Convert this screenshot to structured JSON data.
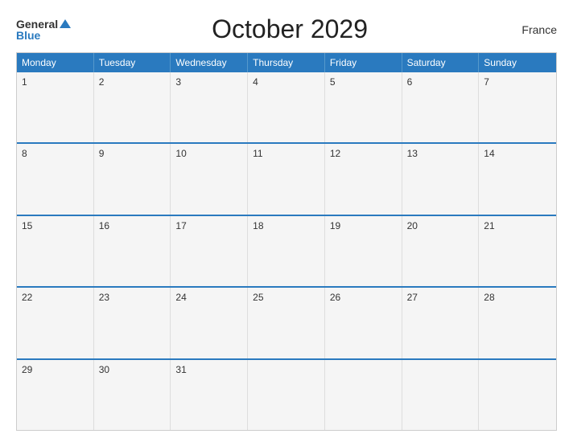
{
  "header": {
    "logo_general": "General",
    "logo_blue": "Blue",
    "title": "October 2029",
    "country": "France"
  },
  "calendar": {
    "days_of_week": [
      "Monday",
      "Tuesday",
      "Wednesday",
      "Thursday",
      "Friday",
      "Saturday",
      "Sunday"
    ],
    "weeks": [
      [
        {
          "num": "1"
        },
        {
          "num": "2"
        },
        {
          "num": "3"
        },
        {
          "num": "4"
        },
        {
          "num": "5"
        },
        {
          "num": "6"
        },
        {
          "num": "7"
        }
      ],
      [
        {
          "num": "8"
        },
        {
          "num": "9"
        },
        {
          "num": "10"
        },
        {
          "num": "11"
        },
        {
          "num": "12"
        },
        {
          "num": "13"
        },
        {
          "num": "14"
        }
      ],
      [
        {
          "num": "15"
        },
        {
          "num": "16"
        },
        {
          "num": "17"
        },
        {
          "num": "18"
        },
        {
          "num": "19"
        },
        {
          "num": "20"
        },
        {
          "num": "21"
        }
      ],
      [
        {
          "num": "22"
        },
        {
          "num": "23"
        },
        {
          "num": "24"
        },
        {
          "num": "25"
        },
        {
          "num": "26"
        },
        {
          "num": "27"
        },
        {
          "num": "28"
        }
      ],
      [
        {
          "num": "29"
        },
        {
          "num": "30"
        },
        {
          "num": "31"
        },
        {
          "num": ""
        },
        {
          "num": ""
        },
        {
          "num": ""
        },
        {
          "num": ""
        }
      ]
    ]
  },
  "colors": {
    "header_bg": "#2a7abf",
    "cell_bg": "#f5f5f5",
    "border": "#2a7abf"
  }
}
